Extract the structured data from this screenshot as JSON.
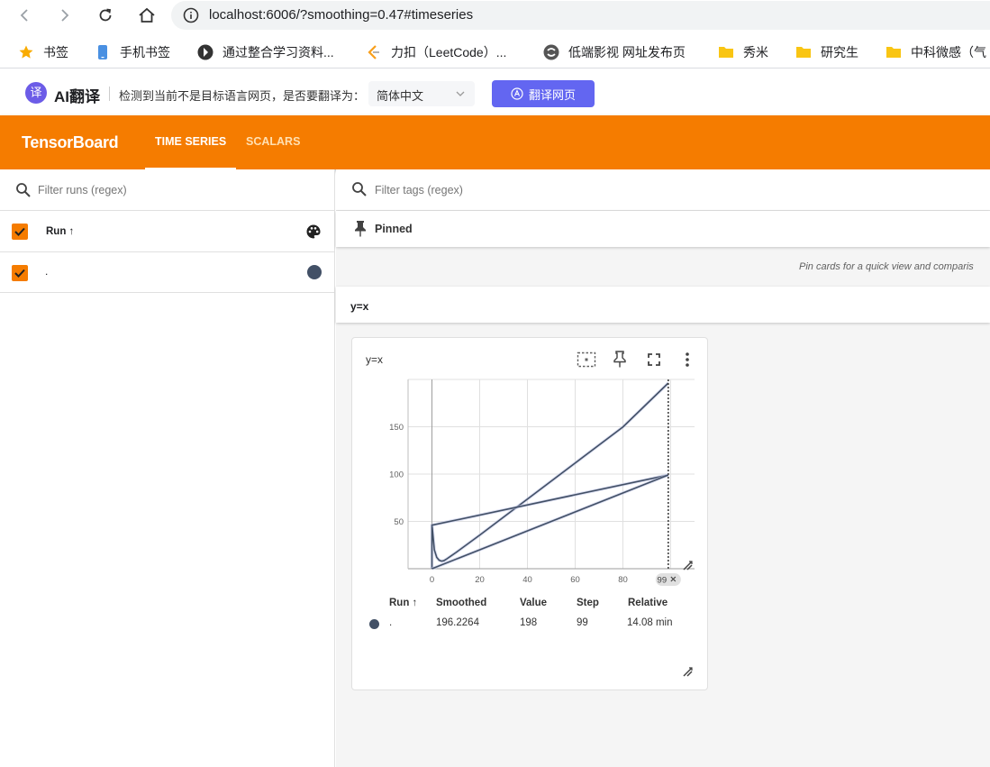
{
  "browser": {
    "url": "localhost:6006/?smoothing=0.47#timeseries",
    "bookmarks": [
      "书签",
      "手机书签",
      "通过整合学习资料...",
      "力扣（LeetCode）...",
      "低端影视 网址发布页",
      "秀米",
      "研究生",
      "中科微感（气"
    ]
  },
  "translate_bar": {
    "logo_glyph": "译",
    "name": "AI翻译",
    "prompt": "检测到当前不是目标语言网页，是否要翻译为：",
    "language": "简体中文",
    "button": "翻译网页"
  },
  "header": {
    "brand": "TensorBoard",
    "tabs": [
      "TIME SERIES",
      "SCALARS"
    ],
    "active_tab": "TIME SERIES"
  },
  "runs": {
    "filter_placeholder": "Filter runs (regex)",
    "column_label": "Run ↑",
    "items": [
      {
        "name": ".",
        "color": "#425066",
        "checked": true
      }
    ]
  },
  "main": {
    "tag_filter_placeholder": "Filter tags (regex)",
    "pinned_label": "Pinned",
    "pinned_hint": "Pin cards for a quick view and comparis",
    "group_title": "y=x"
  },
  "card": {
    "title": "y=x",
    "step_marker": "99",
    "table": {
      "headers": [
        "Run ↑",
        "Smoothed",
        "Value",
        "Step",
        "Relative"
      ],
      "row": {
        "run": ".",
        "smoothed": "196.2264",
        "value": "198",
        "step": "99",
        "relative": "14.08 min"
      }
    }
  },
  "chart_data": {
    "type": "line",
    "title": "y=x",
    "xlabel": "",
    "ylabel": "",
    "xlim": [
      -10,
      110
    ],
    "ylim": [
      0,
      200
    ],
    "xticks": [
      0,
      20,
      40,
      60,
      80
    ],
    "yticks": [
      50,
      100,
      150
    ],
    "grid": true,
    "cursor_step": 99,
    "series": [
      {
        "color": "#425066",
        "x": [
          0,
          0,
          1,
          2,
          3,
          4,
          5,
          6,
          8,
          10,
          20,
          40,
          60,
          80,
          99,
          0,
          0,
          99,
          0,
          99
        ],
        "y": [
          0,
          47,
          20,
          12,
          9,
          8,
          8.5,
          10,
          13.5,
          17,
          35.5,
          73.6,
          111.7,
          149.8,
          196.2,
          46,
          46,
          99,
          0,
          99
        ]
      }
    ]
  }
}
